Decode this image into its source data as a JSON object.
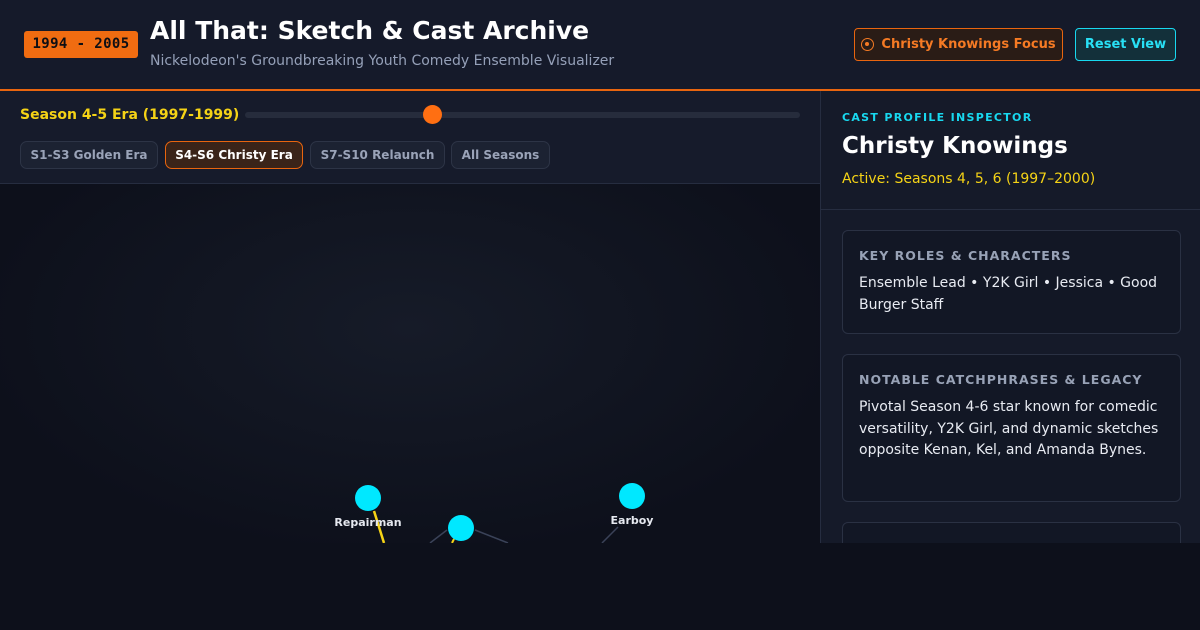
{
  "header": {
    "year_badge": "1994 - 2005",
    "title": "All That: Sketch & Cast Archive",
    "subtitle": "Nickelodeon's Groundbreaking Youth Comedy Ensemble Visualizer",
    "focus_button": "Christy Knowings Focus",
    "reset_button": "Reset View"
  },
  "controls": {
    "era_label": "Season 4-5 Era (1997-1999)",
    "slider_value_percent": 34,
    "chips": [
      {
        "label": "S1-S3 Golden Era",
        "active": false
      },
      {
        "label": "S4-S6 Christy Era",
        "active": true
      },
      {
        "label": "S7-S10 Relaunch",
        "active": false
      },
      {
        "label": "All Seasons",
        "active": false
      }
    ]
  },
  "graph": {
    "node_color": "#00e8ff",
    "highlight_edge_color": "#f5d316",
    "nodes": [
      {
        "label": "Repairman"
      },
      {
        "label": ""
      },
      {
        "label": "Earboy"
      }
    ]
  },
  "inspector": {
    "eyebrow": "CAST PROFILE INSPECTOR",
    "name": "Christy Knowings",
    "active": "Active: Seasons 4, 5, 6 (1997–2000)",
    "cards": [
      {
        "title": "KEY ROLES & CHARACTERS",
        "body": "Ensemble Lead • Y2K Girl • Jessica • Good Burger Staff"
      },
      {
        "title": "NOTABLE CATCHPHRASES & LEGACY",
        "body": "Pivotal Season 4-6 star known for comedic versatility, Y2K Girl, and dynamic sketches opposite Kenan, Kel, and Amanda Bynes."
      },
      {
        "title": "",
        "body": ""
      }
    ]
  },
  "colors": {
    "accent_orange": "#f06c11",
    "accent_cyan": "#18d8ef",
    "accent_yellow": "#f5d316",
    "background": "#0d101b"
  }
}
